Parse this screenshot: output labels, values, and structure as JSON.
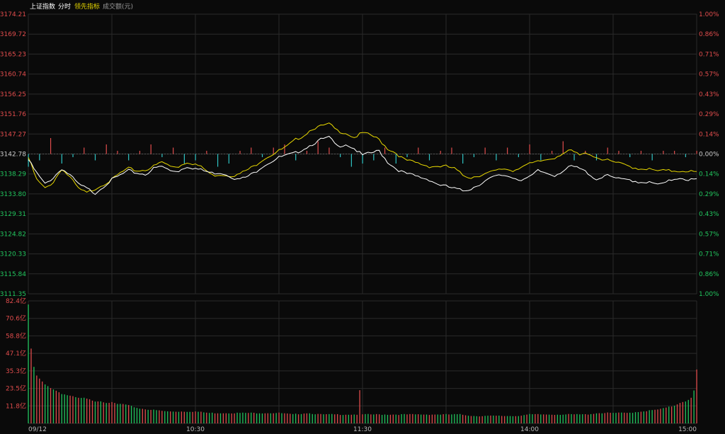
{
  "header": {
    "index_name": "上证指数",
    "mode": "分时",
    "leading": "领先指标",
    "volume": "成交额(元)"
  },
  "colors": {
    "background": "#0a0a0a",
    "grid": "#2a2a2a",
    "up": "#e04c4c",
    "down": "#2fc4c4",
    "down_label": "#22c55e",
    "price_line": "#ffffff",
    "lead_line": "#e8d800",
    "header_text": "#e8d800"
  },
  "chart_data": [
    {
      "type": "line",
      "ticks_left": [
        "3174.21",
        "3169.72",
        "3165.23",
        "3160.74",
        "3156.25",
        "3151.76",
        "3147.27",
        "3142.78",
        "3138.29",
        "3133.80",
        "3129.31",
        "3124.82",
        "3120.33",
        "3115.84",
        "3111.35"
      ],
      "ticks_right": [
        "1.00%",
        "0.86%",
        "0.71%",
        "0.57%",
        "0.43%",
        "0.29%",
        "0.14%",
        "0.00%",
        "0.14%",
        "0.29%",
        "0.43%",
        "0.57%",
        "0.71%",
        "0.86%",
        "1.00%"
      ],
      "ylim": [
        3111.35,
        3174.21
      ],
      "base": 3142.78,
      "x_count": 241,
      "price_keys": [
        [
          0,
          3141.5
        ],
        [
          3,
          3138.5
        ],
        [
          6,
          3136
        ],
        [
          9,
          3137.5
        ],
        [
          12,
          3139.5
        ],
        [
          15,
          3138
        ],
        [
          18,
          3136
        ],
        [
          21,
          3135
        ],
        [
          24,
          3134
        ],
        [
          27,
          3135.5
        ],
        [
          30,
          3137
        ],
        [
          33,
          3138
        ],
        [
          36,
          3139
        ],
        [
          39,
          3138.5
        ],
        [
          42,
          3138.2
        ],
        [
          45,
          3139.5
        ],
        [
          48,
          3140
        ],
        [
          51,
          3139
        ],
        [
          54,
          3139
        ],
        [
          57,
          3140
        ],
        [
          60,
          3139.5
        ],
        [
          63,
          3139
        ],
        [
          66,
          3138.5
        ],
        [
          69,
          3138.6
        ],
        [
          72,
          3138
        ],
        [
          75,
          3137
        ],
        [
          78,
          3137.5
        ],
        [
          81,
          3138.5
        ],
        [
          84,
          3140
        ],
        [
          87,
          3141
        ],
        [
          90,
          3142
        ],
        [
          93,
          3142.5
        ],
        [
          96,
          3143
        ],
        [
          99,
          3144
        ],
        [
          102,
          3145
        ],
        [
          105,
          3146
        ],
        [
          108,
          3146.5
        ],
        [
          111,
          3144.5
        ],
        [
          114,
          3145
        ],
        [
          117,
          3144
        ],
        [
          120,
          3142.5
        ],
        [
          123,
          3143
        ],
        [
          126,
          3143.5
        ],
        [
          129,
          3141
        ],
        [
          132,
          3139.5
        ],
        [
          135,
          3138.5
        ],
        [
          138,
          3138
        ],
        [
          141,
          3137.5
        ],
        [
          144,
          3137
        ],
        [
          147,
          3136
        ],
        [
          150,
          3135.5
        ],
        [
          153,
          3135
        ],
        [
          156,
          3134.5
        ],
        [
          159,
          3135
        ],
        [
          162,
          3136
        ],
        [
          165,
          3137
        ],
        [
          168,
          3137.8
        ],
        [
          171,
          3138
        ],
        [
          174,
          3137.5
        ],
        [
          177,
          3137
        ],
        [
          180,
          3137.5
        ],
        [
          183,
          3139
        ],
        [
          186,
          3138.5
        ],
        [
          189,
          3138
        ],
        [
          192,
          3139
        ],
        [
          195,
          3140
        ],
        [
          198,
          3139.5
        ],
        [
          201,
          3138.5
        ],
        [
          204,
          3137
        ],
        [
          207,
          3138
        ],
        [
          210,
          3137.5
        ],
        [
          213,
          3137
        ],
        [
          216,
          3137
        ],
        [
          219,
          3136.5
        ],
        [
          222,
          3136.5
        ],
        [
          225,
          3136
        ],
        [
          228,
          3136
        ],
        [
          231,
          3137
        ],
        [
          234,
          3137.5
        ],
        [
          237,
          3137
        ],
        [
          240,
          3137
        ]
      ],
      "lead_keys": [
        [
          0,
          3142
        ],
        [
          3,
          3137
        ],
        [
          6,
          3135
        ],
        [
          9,
          3136.5
        ],
        [
          12,
          3139.5
        ],
        [
          15,
          3137.5
        ],
        [
          18,
          3135
        ],
        [
          21,
          3134
        ],
        [
          24,
          3135
        ],
        [
          27,
          3136
        ],
        [
          30,
          3137
        ],
        [
          33,
          3138.5
        ],
        [
          36,
          3139.5
        ],
        [
          39,
          3139
        ],
        [
          42,
          3139.2
        ],
        [
          45,
          3140
        ],
        [
          48,
          3141
        ],
        [
          51,
          3140
        ],
        [
          54,
          3140
        ],
        [
          57,
          3141
        ],
        [
          60,
          3140.5
        ],
        [
          63,
          3139.5
        ],
        [
          66,
          3138
        ],
        [
          69,
          3138.2
        ],
        [
          72,
          3138
        ],
        [
          75,
          3138
        ],
        [
          78,
          3139
        ],
        [
          81,
          3140
        ],
        [
          84,
          3141.5
        ],
        [
          87,
          3142.5
        ],
        [
          90,
          3143.5
        ],
        [
          93,
          3144.5
        ],
        [
          96,
          3146
        ],
        [
          99,
          3147
        ],
        [
          102,
          3148.5
        ],
        [
          105,
          3149
        ],
        [
          108,
          3149.5
        ],
        [
          111,
          3148
        ],
        [
          114,
          3147.5
        ],
        [
          117,
          3146.5
        ],
        [
          120,
          3147.5
        ],
        [
          123,
          3147
        ],
        [
          126,
          3146
        ],
        [
          129,
          3144
        ],
        [
          132,
          3143
        ],
        [
          135,
          3141.5
        ],
        [
          138,
          3141
        ],
        [
          141,
          3140.5
        ],
        [
          144,
          3140
        ],
        [
          147,
          3140
        ],
        [
          150,
          3140
        ],
        [
          153,
          3139.5
        ],
        [
          156,
          3138
        ],
        [
          159,
          3137.5
        ],
        [
          162,
          3138
        ],
        [
          165,
          3138.5
        ],
        [
          168,
          3139
        ],
        [
          171,
          3139.5
        ],
        [
          174,
          3139
        ],
        [
          177,
          3140
        ],
        [
          180,
          3140.5
        ],
        [
          183,
          3141
        ],
        [
          186,
          3141.5
        ],
        [
          189,
          3142
        ],
        [
          192,
          3143
        ],
        [
          195,
          3143.5
        ],
        [
          198,
          3142.5
        ],
        [
          201,
          3143
        ],
        [
          204,
          3142
        ],
        [
          207,
          3141.5
        ],
        [
          210,
          3141
        ],
        [
          213,
          3140.5
        ],
        [
          216,
          3140
        ],
        [
          219,
          3139.5
        ],
        [
          222,
          3139.5
        ],
        [
          225,
          3139
        ],
        [
          228,
          3139
        ],
        [
          231,
          3139
        ],
        [
          234,
          3139
        ],
        [
          237,
          3139
        ],
        [
          240,
          3138.6
        ]
      ],
      "lead_bars": [
        [
          0,
          -4
        ],
        [
          4,
          -2
        ],
        [
          8,
          5
        ],
        [
          12,
          -3
        ],
        [
          16,
          -1
        ],
        [
          20,
          2
        ],
        [
          24,
          -2
        ],
        [
          28,
          3
        ],
        [
          32,
          1
        ],
        [
          36,
          -2
        ],
        [
          40,
          1
        ],
        [
          44,
          3
        ],
        [
          48,
          -1
        ],
        [
          52,
          2
        ],
        [
          56,
          -3
        ],
        [
          60,
          -2
        ],
        [
          64,
          1
        ],
        [
          68,
          -4
        ],
        [
          72,
          -3
        ],
        [
          76,
          1
        ],
        [
          80,
          2
        ],
        [
          84,
          -1
        ],
        [
          88,
          2
        ],
        [
          92,
          3
        ],
        [
          96,
          -2
        ],
        [
          100,
          1
        ],
        [
          104,
          4
        ],
        [
          108,
          2
        ],
        [
          112,
          -1
        ],
        [
          116,
          -4
        ],
        [
          120,
          -3
        ],
        [
          124,
          -2
        ],
        [
          128,
          2
        ],
        [
          132,
          -3
        ],
        [
          136,
          -1
        ],
        [
          140,
          2
        ],
        [
          144,
          -2
        ],
        [
          148,
          1
        ],
        [
          152,
          2
        ],
        [
          156,
          -3
        ],
        [
          160,
          -1
        ],
        [
          164,
          2
        ],
        [
          168,
          -2
        ],
        [
          172,
          2
        ],
        [
          176,
          -1
        ],
        [
          180,
          3
        ],
        [
          184,
          -2
        ],
        [
          188,
          1
        ],
        [
          192,
          4
        ],
        [
          196,
          -2
        ],
        [
          200,
          1
        ],
        [
          204,
          -2
        ],
        [
          208,
          2
        ],
        [
          212,
          1
        ],
        [
          216,
          -1
        ],
        [
          220,
          1
        ],
        [
          224,
          -2
        ],
        [
          228,
          1
        ],
        [
          232,
          1
        ],
        [
          236,
          -1
        ],
        [
          240,
          1
        ]
      ],
      "x_ticks": [
        {
          "label": "09/12",
          "i": 0
        },
        {
          "label": "10:30",
          "i": 60
        },
        {
          "label": "11:30",
          "i": 120
        },
        {
          "label": "14:00",
          "i": 180
        },
        {
          "label": "15:00",
          "i": 240
        }
      ]
    },
    {
      "type": "bar",
      "ticks": [
        "82.4亿",
        "70.6亿",
        "58.8亿",
        "47.1亿",
        "35.3亿",
        "23.5亿",
        "11.8亿"
      ],
      "ylim": [
        0,
        82.4
      ],
      "volume_keys": [
        [
          0,
          80
        ],
        [
          1,
          50
        ],
        [
          2,
          38
        ],
        [
          3,
          32
        ],
        [
          4,
          30
        ],
        [
          5,
          28
        ],
        [
          6,
          26
        ],
        [
          7,
          25
        ],
        [
          8,
          24
        ],
        [
          9,
          23
        ],
        [
          10,
          22
        ],
        [
          11,
          21
        ],
        [
          12,
          20
        ],
        [
          14,
          19
        ],
        [
          16,
          18
        ],
        [
          18,
          17
        ],
        [
          20,
          17
        ],
        [
          22,
          16
        ],
        [
          24,
          15
        ],
        [
          26,
          15
        ],
        [
          28,
          14
        ],
        [
          30,
          14
        ],
        [
          32,
          13
        ],
        [
          34,
          13
        ],
        [
          36,
          12
        ],
        [
          38,
          11
        ],
        [
          40,
          10
        ],
        [
          45,
          9
        ],
        [
          50,
          8
        ],
        [
          55,
          8
        ],
        [
          60,
          8
        ],
        [
          65,
          7
        ],
        [
          70,
          7
        ],
        [
          75,
          7
        ],
        [
          80,
          7
        ],
        [
          85,
          7
        ],
        [
          90,
          7
        ],
        [
          95,
          6
        ],
        [
          100,
          7
        ],
        [
          105,
          6
        ],
        [
          110,
          6
        ],
        [
          115,
          6
        ],
        [
          118,
          6
        ],
        [
          119,
          22
        ],
        [
          120,
          6
        ],
        [
          125,
          6
        ],
        [
          130,
          6
        ],
        [
          135,
          6
        ],
        [
          140,
          6
        ],
        [
          145,
          6
        ],
        [
          150,
          6
        ],
        [
          155,
          6
        ],
        [
          160,
          5
        ],
        [
          165,
          5
        ],
        [
          170,
          5
        ],
        [
          175,
          5
        ],
        [
          180,
          6
        ],
        [
          185,
          6
        ],
        [
          190,
          6
        ],
        [
          195,
          6
        ],
        [
          200,
          6
        ],
        [
          205,
          7
        ],
        [
          210,
          7
        ],
        [
          215,
          7
        ],
        [
          220,
          8
        ],
        [
          225,
          9
        ],
        [
          228,
          10
        ],
        [
          230,
          11
        ],
        [
          232,
          12
        ],
        [
          234,
          14
        ],
        [
          236,
          15
        ],
        [
          238,
          17
        ],
        [
          239,
          22
        ],
        [
          240,
          36
        ]
      ]
    }
  ]
}
